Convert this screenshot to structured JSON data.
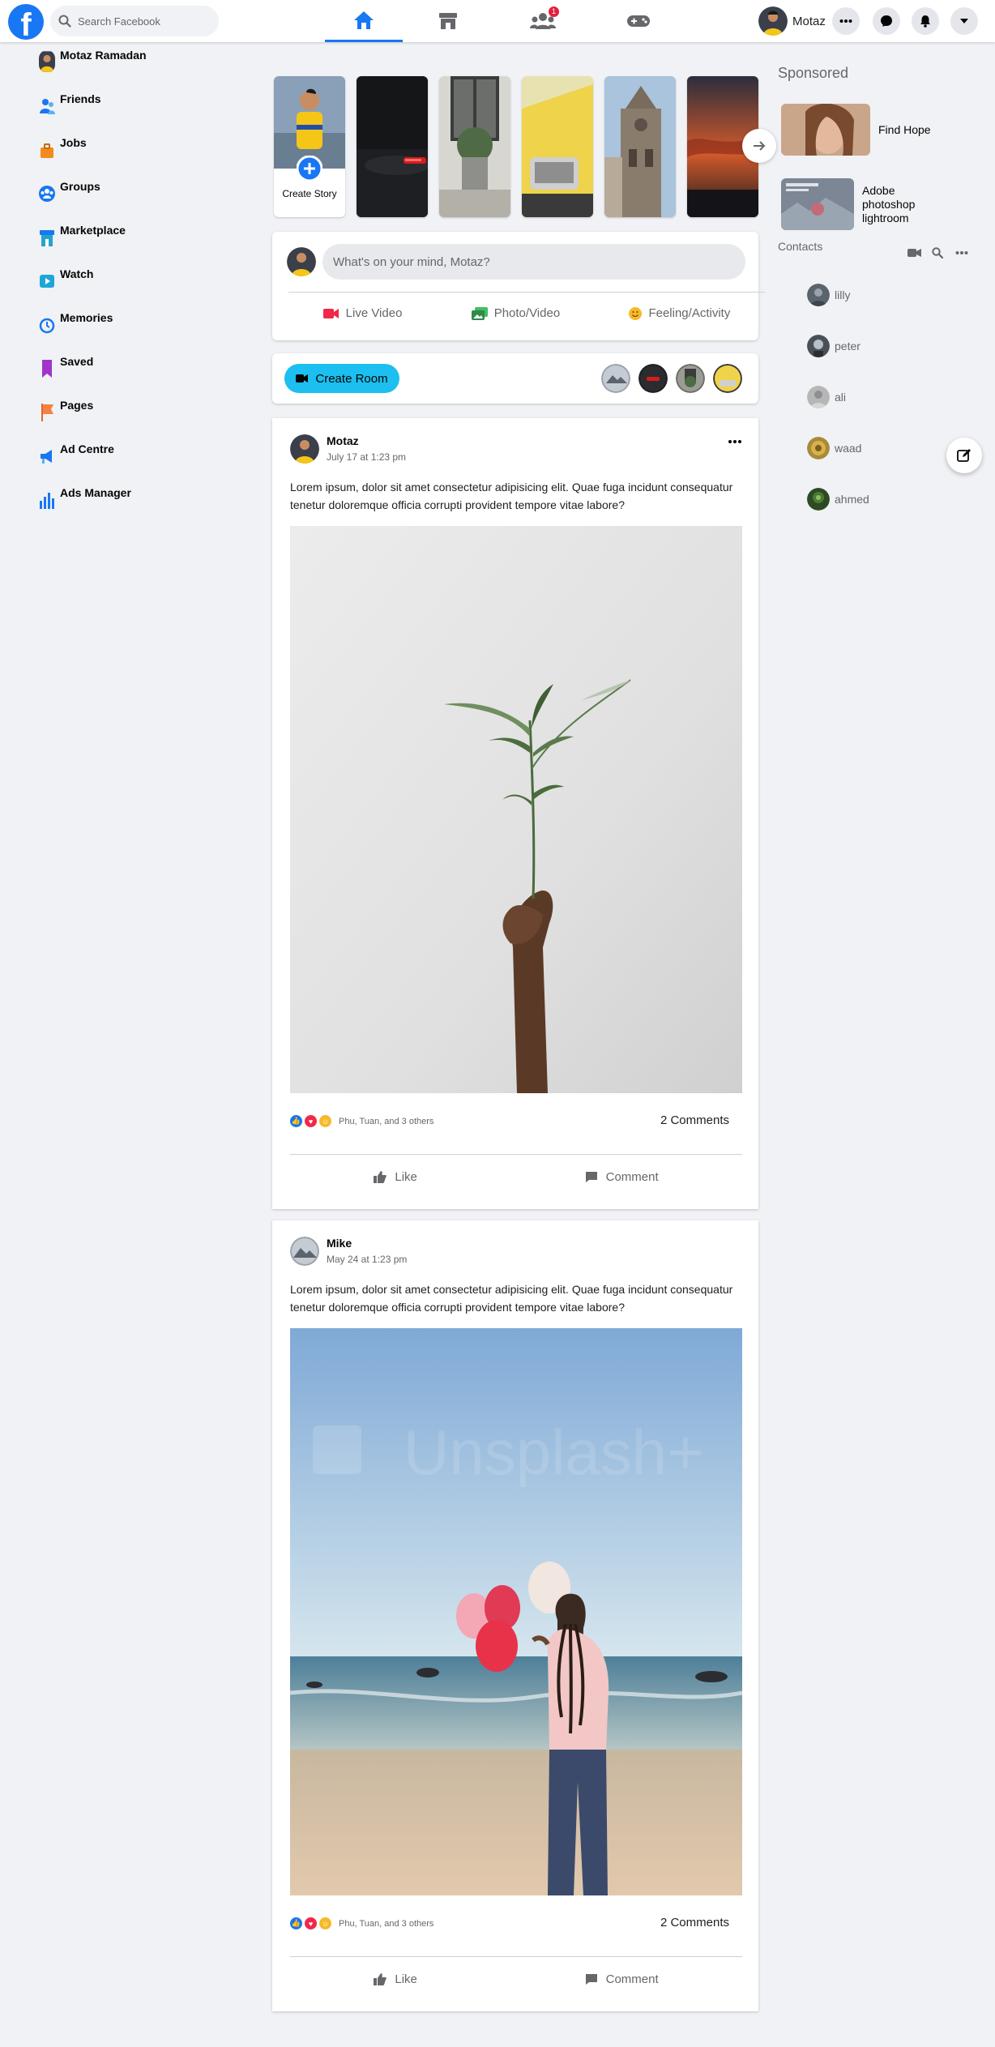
{
  "header": {
    "logo": "f",
    "search_placeholder": "Search Facebook",
    "nav_tabs": [
      {
        "icon": "home-icon",
        "active": true
      },
      {
        "icon": "marketplace-store-icon",
        "active": false
      },
      {
        "icon": "groups-icon",
        "active": false,
        "badge": "1"
      },
      {
        "icon": "gaming-controller-icon",
        "active": false
      }
    ],
    "profile_name": "Motaz",
    "right_icons": [
      "more-dots-icon",
      "messenger-icon",
      "bell-icon",
      "caret-down-icon"
    ]
  },
  "sidebar": {
    "items": [
      {
        "label": "Motaz Ramadan",
        "icon": "avatar"
      },
      {
        "label": "Friends",
        "icon": "friends-icon"
      },
      {
        "label": "Jobs",
        "icon": "jobs-briefcase-icon"
      },
      {
        "label": "Groups",
        "icon": "groups-icon"
      },
      {
        "label": "Marketplace",
        "icon": "marketplace-icon"
      },
      {
        "label": "Watch",
        "icon": "watch-play-icon"
      },
      {
        "label": "Memories",
        "icon": "memories-clock-icon"
      },
      {
        "label": "Saved",
        "icon": "saved-bookmark-icon"
      },
      {
        "label": "Pages",
        "icon": "pages-flag-icon"
      },
      {
        "label": "Ad Centre",
        "icon": "ad-centre-megaphone-icon"
      },
      {
        "label": "Ads Manager",
        "icon": "ads-manager-chart-icon"
      }
    ]
  },
  "stories": {
    "create_label": "Create Story"
  },
  "composer": {
    "placeholder": "What's on your mind, Motaz?",
    "actions": [
      {
        "label": "Live Video",
        "icon": "live-video-icon",
        "color": "#f02849"
      },
      {
        "label": "Photo/Video",
        "icon": "photo-video-icon",
        "color": "#45bd62"
      },
      {
        "label": "Feeling/Activity",
        "icon": "feeling-emoji-icon",
        "color": "#f7b928"
      }
    ]
  },
  "rooms": {
    "create_label": "Create Room"
  },
  "posts": [
    {
      "author": "Motaz",
      "time": "July 17 at 1:23 pm",
      "text": "Lorem ipsum, dolor sit amet consectetur adipisicing elit. Quae fuga incidunt consequatur tenetur doloremque officia corrupti provident tempore vitae labore?",
      "reactions_text": "Phu, Tuan, and 3 others",
      "comments_text": "2 Comments",
      "like_label": "Like",
      "comment_label": "Comment"
    },
    {
      "author": "Mike",
      "time": "May 24 at 1:23 pm",
      "text": "Lorem ipsum, dolor sit amet consectetur adipisicing elit. Quae fuga incidunt consequatur tenetur doloremque officia corrupti provident tempore vitae labore?",
      "reactions_text": "Phu, Tuan, and 3 others",
      "comments_text": "2 Comments",
      "like_label": "Like",
      "comment_label": "Comment"
    }
  ],
  "right": {
    "sponsored_title": "Sponsored",
    "sponsored": [
      {
        "label": "Find Hope"
      },
      {
        "label": "Adobe photoshop lightroom"
      }
    ],
    "contacts_title": "Contacts",
    "contacts": [
      "lilly",
      "peter",
      "ali",
      "waad",
      "ahmed"
    ]
  },
  "colors": {
    "brand": "#1877f2",
    "background": "#f0f2f5",
    "room_button": "#1cbfef",
    "badge": "#e41e3f"
  }
}
